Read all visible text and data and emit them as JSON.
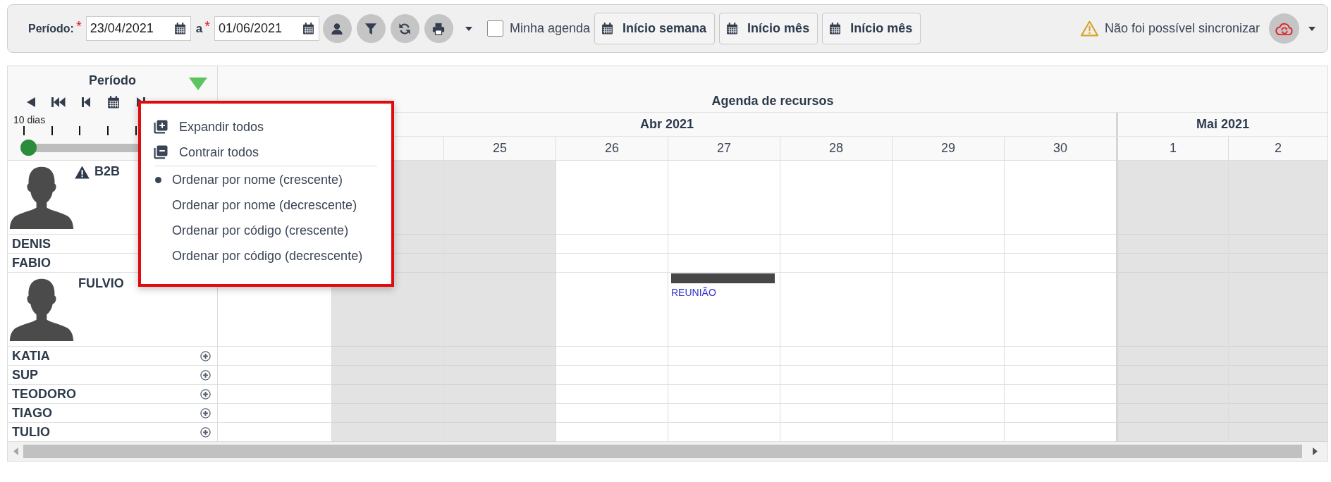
{
  "toolbar": {
    "period_fields": [
      {
        "label": "Período:",
        "required_mark": "*",
        "value": "23/04/2021"
      },
      {
        "label": "a",
        "required_mark": "*",
        "value": "01/06/2021"
      }
    ],
    "my_agenda": {
      "label": "Minha agenda",
      "checked": false
    },
    "shortcut_buttons": [
      "Início semana",
      "Início mês",
      "Início mês"
    ],
    "sync_status": "Não foi possível sincronizar"
  },
  "period_panel": {
    "title": "Período",
    "slider": {
      "label": "10 dias",
      "level": 0
    }
  },
  "options_menu": {
    "actions": [
      {
        "kind": "expand",
        "label": "Expandir todos"
      },
      {
        "kind": "collapse",
        "label": "Contrair todos"
      }
    ],
    "sort_options": [
      {
        "label": "Ordenar por nome (crescente)",
        "selected": true
      },
      {
        "label": "Ordenar por nome (decrescente)",
        "selected": false
      },
      {
        "label": "Ordenar por código (crescente)",
        "selected": false
      },
      {
        "label": "Ordenar por código (decrescente)",
        "selected": false
      }
    ]
  },
  "calendar": {
    "title": "Agenda de recursos",
    "months": [
      {
        "label": "Abr 2021",
        "days": [
          {
            "weekend": false
          },
          {
            "weekend": true
          },
          {
            "day": "25",
            "weekend": true
          },
          {
            "day": "26",
            "weekend": false
          },
          {
            "day": "27",
            "weekend": false
          },
          {
            "day": "28",
            "weekend": false
          },
          {
            "day": "29",
            "weekend": false
          },
          {
            "day": "30",
            "weekend": false
          }
        ]
      },
      {
        "label": "Mai 2021",
        "days": [
          {
            "day": "1",
            "weekend": true
          },
          {
            "day": "2",
            "weekend": true
          }
        ]
      }
    ]
  },
  "resources": [
    {
      "name": "B2B",
      "kind": "photo",
      "warning": true
    },
    {
      "name": "DENIS",
      "kind": "plain",
      "warning": false
    },
    {
      "name": "FABIO",
      "kind": "plain",
      "warning": false
    },
    {
      "name": "FULVIO",
      "kind": "photo",
      "warning": false,
      "expandable": false,
      "slots": [
        {
          "booked": false
        },
        {
          "booked": false
        },
        {
          "booked": false
        },
        {
          "booked": false
        },
        {
          "booked": true,
          "label": "REUNIÃO"
        }
      ]
    },
    {
      "name": "KATIA",
      "kind": "plain",
      "warning": false,
      "expandable": true
    },
    {
      "name": "SUP",
      "kind": "plain",
      "warning": false,
      "expandable": true
    },
    {
      "name": "TEODORO",
      "kind": "plain",
      "warning": false,
      "expandable": true
    },
    {
      "name": "TIAGO",
      "kind": "plain",
      "warning": false,
      "expandable": true
    },
    {
      "name": "TULIO",
      "kind": "plain",
      "warning": false,
      "expandable": true
    }
  ]
}
